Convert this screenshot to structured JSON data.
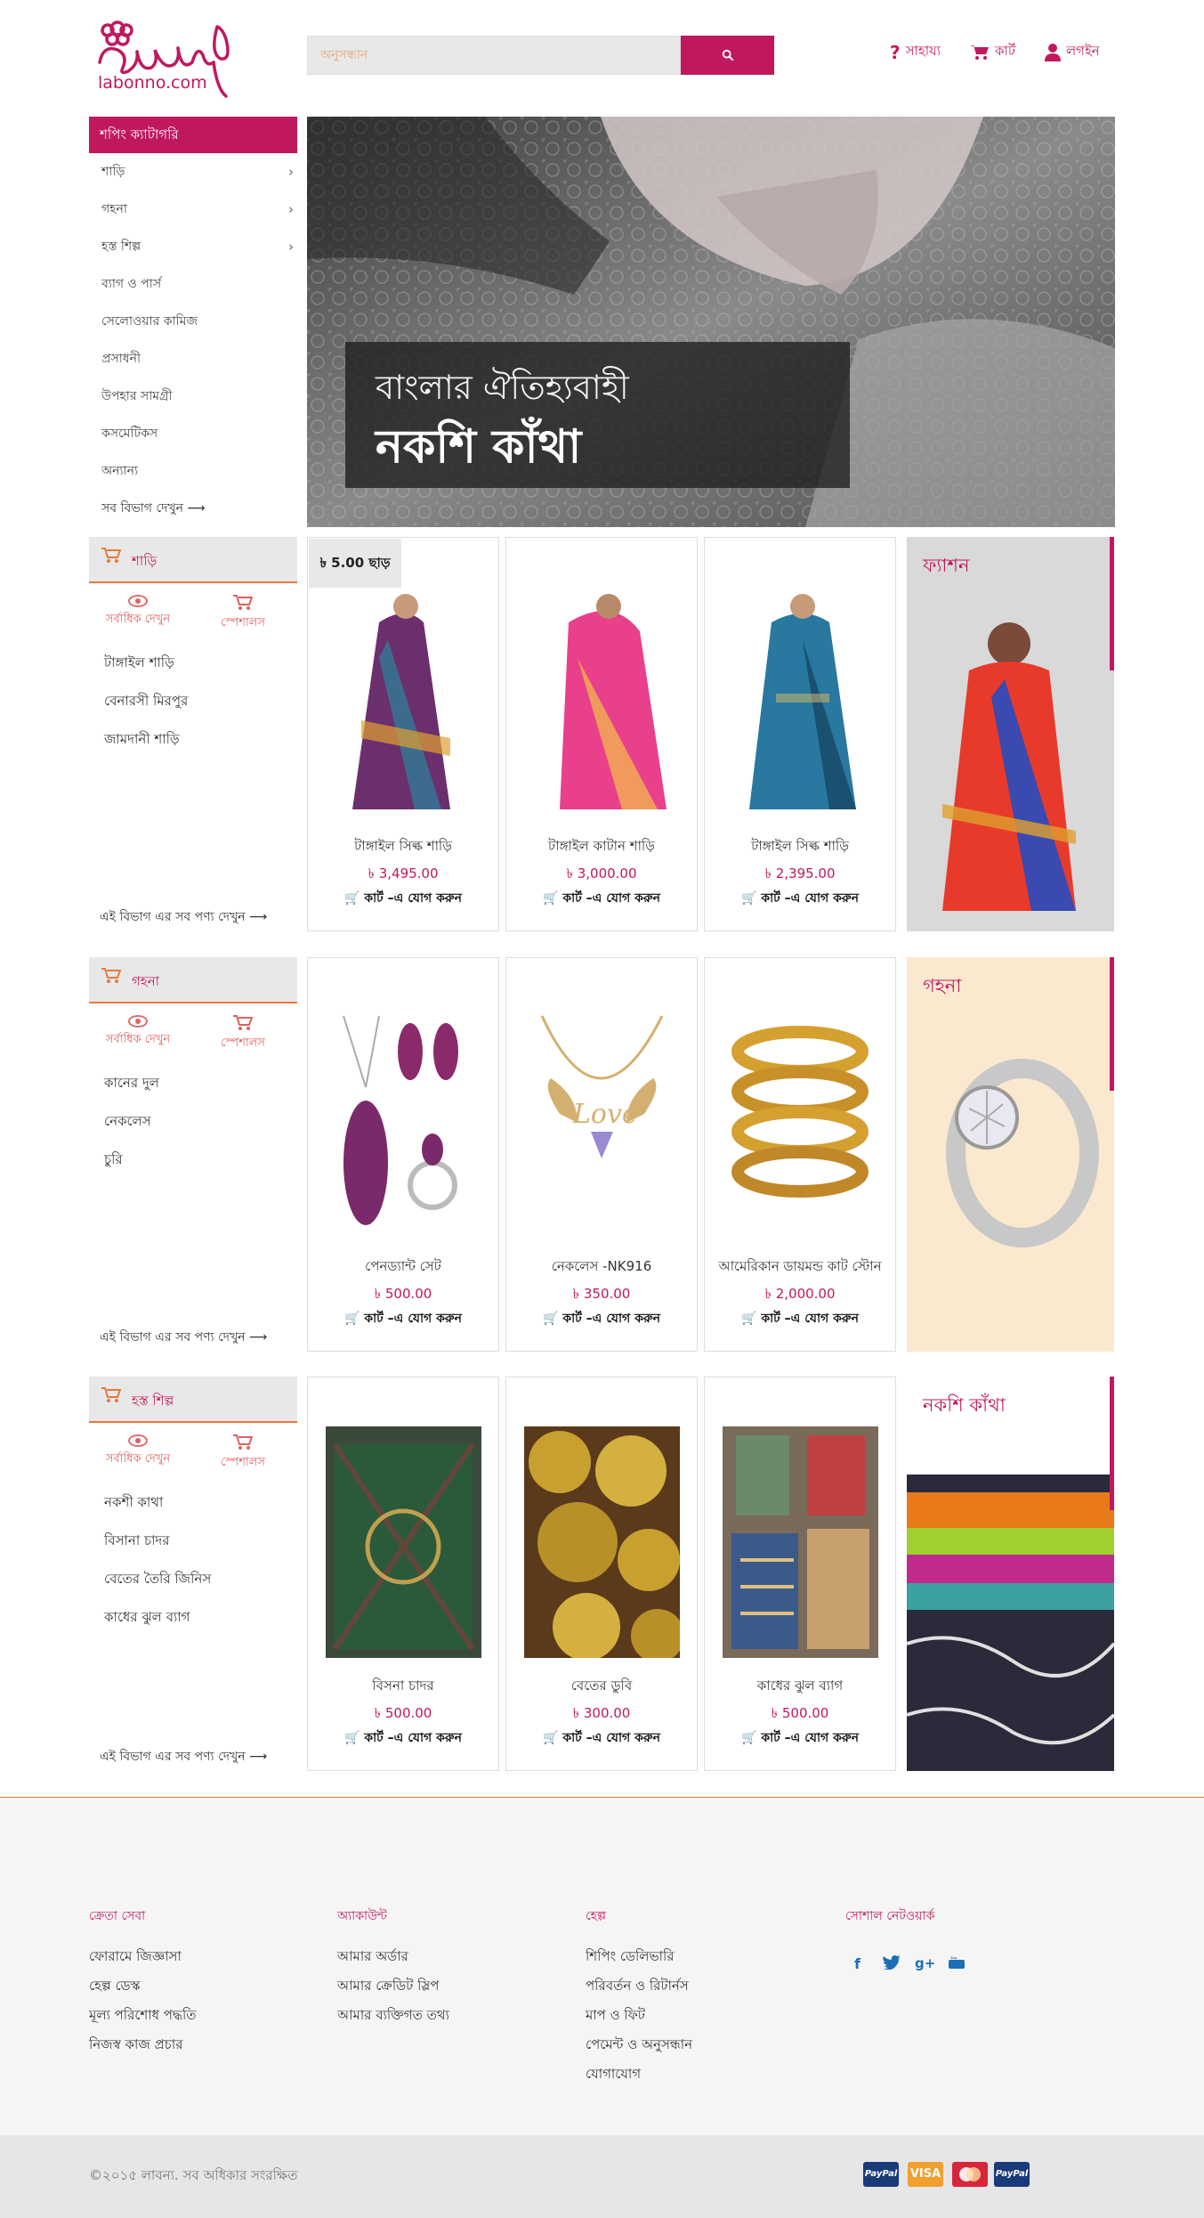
{
  "header": {
    "logo_text": "labonno.com",
    "search_placeholder": "অনুসন্ধান",
    "links": {
      "help": "সাহায্য",
      "cart": "কার্ট",
      "login": "লগইন"
    }
  },
  "categories": {
    "title": "শপিং ক্যাটাগরি",
    "items": [
      {
        "label": "শাড়ি",
        "has_sub": true
      },
      {
        "label": "গহনা",
        "has_sub": true
      },
      {
        "label": "হস্ত শিল্প",
        "has_sub": true
      },
      {
        "label": "ব্যাগ ও পার্স",
        "has_sub": false
      },
      {
        "label": "সেলোওয়ার কামিজ",
        "has_sub": false
      },
      {
        "label": "প্রসাধনী",
        "has_sub": false
      },
      {
        "label": "উপহার সামগ্রী",
        "has_sub": false
      },
      {
        "label": "কসমেটিকস",
        "has_sub": false
      },
      {
        "label": "অন্যান্য",
        "has_sub": false
      }
    ],
    "see_all": "সব বিভাগ দেখুন ⟶"
  },
  "banner": {
    "subtitle": "বাংলার ঐতিহ্যবাহী",
    "title": "নকশি কাঁথা"
  },
  "sections": [
    {
      "title": "শাড়ি",
      "opt_popular": "সর্বাধিক দেখুন",
      "opt_special": "স্পেশালস",
      "sublinks": [
        "টাঙ্গাইল শাড়ি",
        "বেনারসী মিরপুর",
        "জামদানী শাড়ি"
      ],
      "see_all": "এই বিভাগ এর সব পণ্য দেখুন ⟶",
      "promo": "ফ্যাশন",
      "products": [
        {
          "name": "টাঙ্গাইল সিল্ক শাড়ি",
          "price": "৳ 3,495.00",
          "add": "কার্ট –এ যোগ করুন",
          "discount": "৳ 5.00 ছাড়"
        },
        {
          "name": "টাঙ্গাইল কাটান শাড়ি",
          "price": "৳ 3,000.00",
          "add": "কার্ট –এ যোগ করুন"
        },
        {
          "name": "টাঙ্গাইল সিল্ক শাড়ি",
          "price": "৳ 2,395.00",
          "add": "কার্ট –এ যোগ করুন"
        }
      ]
    },
    {
      "title": "গহনা",
      "opt_popular": "সর্বাধিক দেখুন",
      "opt_special": "স্পেশালস",
      "sublinks": [
        "কানের দুল",
        "নেকলেস",
        "চুরি"
      ],
      "see_all": "এই বিভাগ এর সব পণ্য দেখুন ⟶",
      "promo": "গহনা",
      "products": [
        {
          "name": "পেনড্যান্ট সেট",
          "price": "৳ 500.00",
          "add": "কার্ট –এ যোগ করুন"
        },
        {
          "name": "নেকলেস -NK916",
          "price": "৳ 350.00",
          "add": "কার্ট –এ যোগ করুন"
        },
        {
          "name": "আমেরিকান ডায়মন্ড কাট স্টোন",
          "price": "৳ 2,000.00",
          "add": "কার্ট –এ যোগ করুন"
        }
      ]
    },
    {
      "title": "হস্ত শিল্প",
      "opt_popular": "সর্বাধিক দেখুন",
      "opt_special": "স্পেশালস",
      "sublinks": [
        "নকশী কাথা",
        "বিসানা চাদর",
        "বেতের তৈরি জিনিস",
        "কাধের ঝুল ব্যাগ"
      ],
      "see_all": "এই বিভাগ এর সব পণ্য দেখুন ⟶",
      "promo": "নকশি কাঁথা",
      "products": [
        {
          "name": "বিসনা চাদর",
          "price": "৳ 500.00",
          "add": "কার্ট –এ যোগ করুন"
        },
        {
          "name": "বেতের ডুবি",
          "price": "৳ 300.00",
          "add": "কার্ট –এ যোগ করুন"
        },
        {
          "name": "কাধের ঝুল ব্যাগ",
          "price": "৳ 500.00",
          "add": "কার্ট –এ যোগ করুন"
        }
      ]
    }
  ],
  "footer": {
    "columns": [
      {
        "title": "ক্রেতা সেবা",
        "links": [
          "ফোরামে জিজ্ঞাসা",
          "হেল্প ডেস্ক",
          "মূল্য পরিশোধ পদ্ধতি",
          "নিজস্ব কাজ প্রচার"
        ]
      },
      {
        "title": "অ্যাকাউন্ট",
        "links": [
          "আমার অর্ডার",
          "আমার ক্রেডিট স্লিপ",
          "আমার ব্যক্তিগত তথ্য"
        ]
      },
      {
        "title": "হেল্প",
        "links": [
          "শিপিং ডেলিভারি",
          "পরিবর্তন ও রিটার্নস",
          "মাপ ও ফিট",
          "পেমেন্ট ও অনুসন্ধান",
          "যোগাযোগ"
        ]
      },
      {
        "title": "সোশাল নেটওয়ার্ক",
        "links": []
      }
    ],
    "social": [
      "f",
      "t",
      "g+",
      "yt"
    ],
    "copyright": "©২০১৫ লাবন্য. সব অধিকার সংরক্ষিত",
    "payments": [
      "PayPal",
      "VISA",
      "MC",
      "PayPal"
    ]
  },
  "colors": {
    "brand": "#c0185f",
    "accent": "#e8793a"
  }
}
